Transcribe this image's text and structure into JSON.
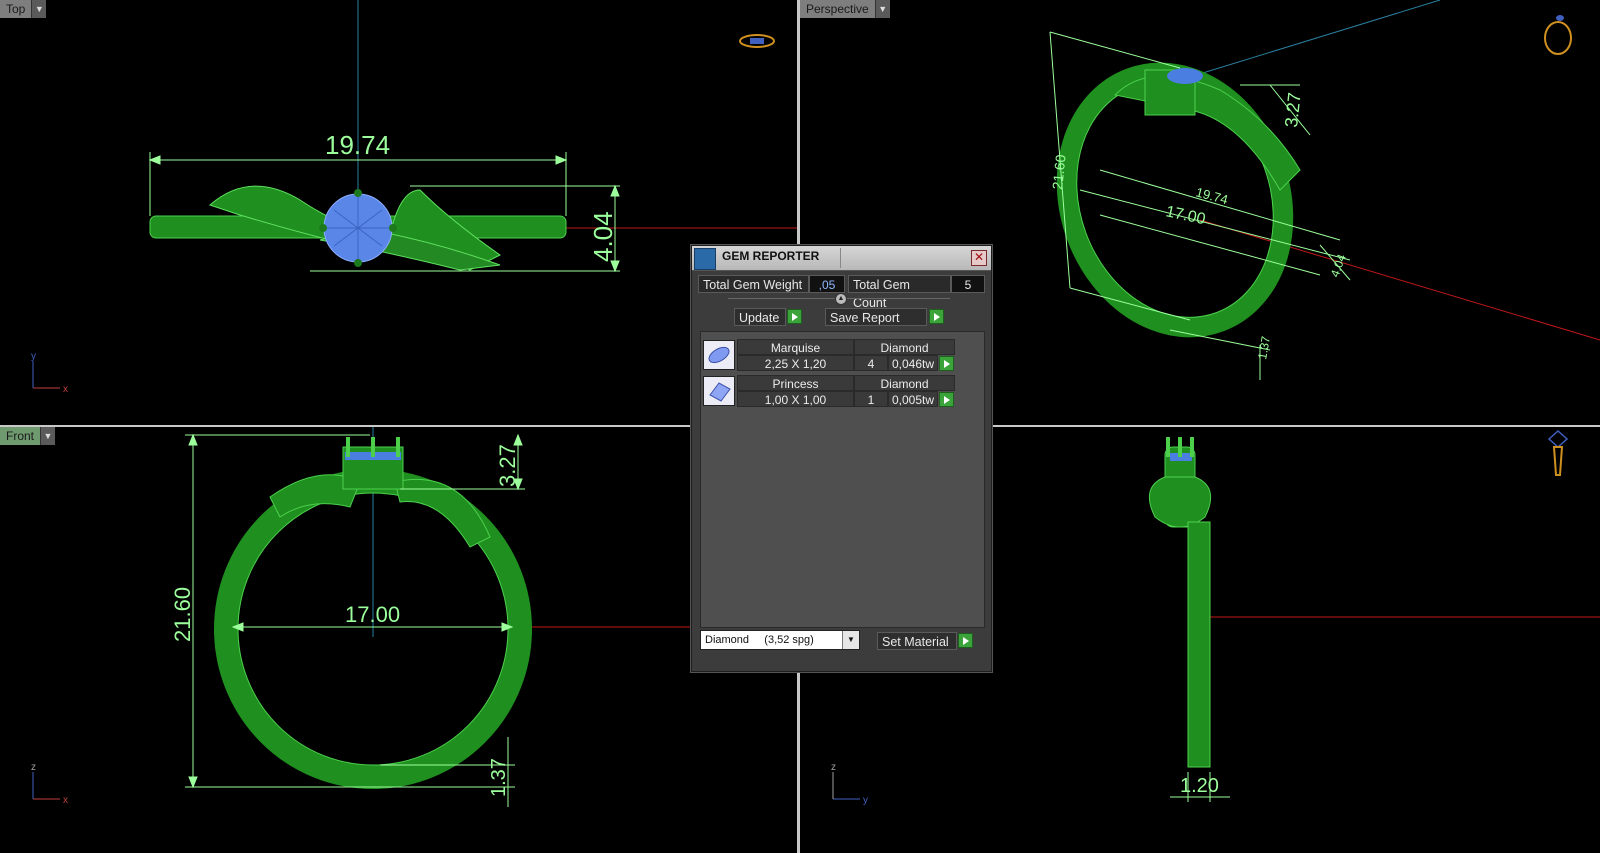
{
  "viewports": {
    "top": {
      "label": "Top",
      "dims": {
        "width": "19.74",
        "height": "4.04"
      },
      "axis_x": "x",
      "axis_y": "y"
    },
    "perspective": {
      "label": "Perspective",
      "dims": {
        "height": "21.60",
        "prong": "3.27",
        "width": "19.74",
        "inner": "17.00",
        "thick": "4.04",
        "band": "1.37"
      }
    },
    "front": {
      "label": "Front",
      "dims": {
        "height": "21.60",
        "prong": "3.27",
        "inner": "17.00",
        "band": "1.37"
      },
      "axis_x": "x",
      "axis_y": "z"
    },
    "right": {
      "dims": {
        "width": "1.20"
      },
      "axis_x": "y",
      "axis_y": "z"
    }
  },
  "gem_reporter": {
    "title": "GEM REPORTER",
    "total_weight_label": "Total Gem Weight",
    "total_weight_value": ",05",
    "total_count_label": "Total Gem Count",
    "total_count_value": "5",
    "update_label": "Update",
    "save_label": "Save Report",
    "gems": [
      {
        "cut": "Marquise",
        "material": "Diamond",
        "size": "2,25 X 1,20",
        "count": "4",
        "weight": "0,046tw"
      },
      {
        "cut": "Princess",
        "material": "Diamond",
        "size": "1,00 X 1,00",
        "count": "1",
        "weight": "0,005tw"
      }
    ],
    "material_select": "Diamond     (3,52 spg)",
    "set_material_label": "Set Material"
  },
  "colors": {
    "ring": "#1f8f1f",
    "gem": "#4a7ee0",
    "dimension": "#9cff9c",
    "axis_red": "#c01818",
    "axis_blue": "#2a7fa0"
  }
}
